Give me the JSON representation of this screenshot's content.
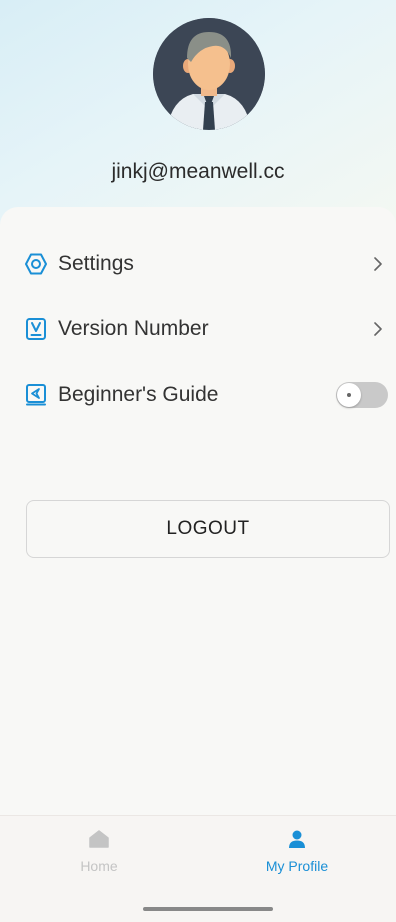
{
  "profile": {
    "email": "jinkj@meanwell.cc"
  },
  "menu": {
    "items": [
      {
        "label": "Settings",
        "icon": "settings-icon",
        "control": "chevron"
      },
      {
        "label": "Version Number",
        "icon": "version-icon",
        "control": "chevron"
      },
      {
        "label": "Beginner's Guide",
        "icon": "guide-icon",
        "control": "toggle",
        "toggle_on": false
      }
    ]
  },
  "logout": {
    "label": "LOGOUT"
  },
  "tabbar": {
    "tabs": [
      {
        "label": "Home",
        "icon": "home-icon",
        "active": false
      },
      {
        "label": "My Profile",
        "icon": "profile-icon",
        "active": true
      }
    ]
  },
  "colors": {
    "accent": "#1a8fd6",
    "inactive": "#c4c4c4"
  }
}
